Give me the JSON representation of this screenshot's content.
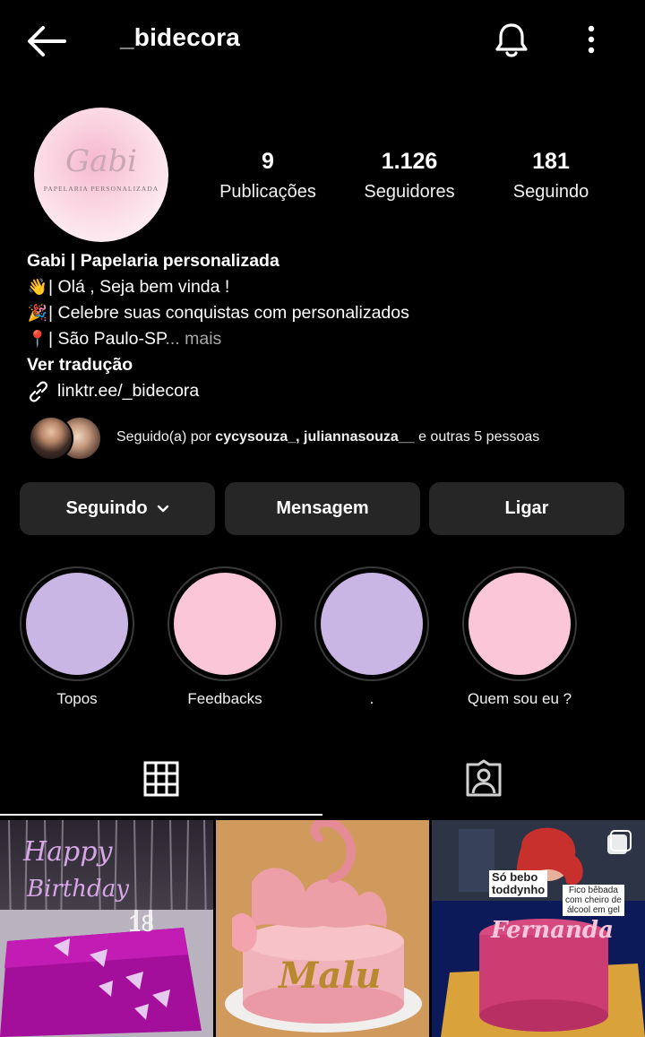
{
  "header": {
    "username": "_bidecora",
    "icons": {
      "back": "arrow-left-icon",
      "notifications": "bell-icon",
      "more": "more-vertical-icon"
    }
  },
  "profile": {
    "avatar_brand": "Gabi",
    "avatar_subtitle": "PAPELARIA PERSONALIZADA",
    "stats": [
      {
        "value": "9",
        "label": "Publicações"
      },
      {
        "value": "1.126",
        "label": "Seguidores"
      },
      {
        "value": "181",
        "label": "Seguindo"
      }
    ]
  },
  "bio": {
    "name": "Gabi | Papelaria personalizada",
    "line1": "| Olá , Seja bem vinda !",
    "line2": "| Celebre suas conquistas com personalizados",
    "line3": "| São Paulo-SP",
    "more": "... mais",
    "translate": "Ver tradução",
    "link": "linktr.ee/_bidecora",
    "emoji1": "👋",
    "emoji2": "🎉",
    "emoji3": "📍"
  },
  "followed_by": {
    "prefix": "Seguido(a) por ",
    "names": "cycysouza_, juliannasouza__",
    "suffix": " e outras 5 pessoas"
  },
  "actions": {
    "following": "Seguindo",
    "message": "Mensagem",
    "call": "Ligar"
  },
  "highlights": [
    {
      "label": "Topos",
      "color": "#c9b6e4"
    },
    {
      "label": "Feedbacks",
      "color": "#fbc6d8"
    },
    {
      "label": ".",
      "color": "#c9b6e4"
    },
    {
      "label": "Quem sou eu ?",
      "color": "#fbc6d8"
    }
  ],
  "tabs": {
    "grid": "grid-icon",
    "tagged": "tagged-user-icon"
  },
  "posts": [
    {
      "text1": "Happy",
      "text2": "Birthday",
      "number": "18"
    },
    {
      "name": "Malu"
    },
    {
      "caption1": "Só bebo",
      "caption2": "toddynho",
      "caption3": "Fico bêbada",
      "caption4": "com cheiro de",
      "caption5": "álcool em gel",
      "name": "Fernanda"
    }
  ]
}
